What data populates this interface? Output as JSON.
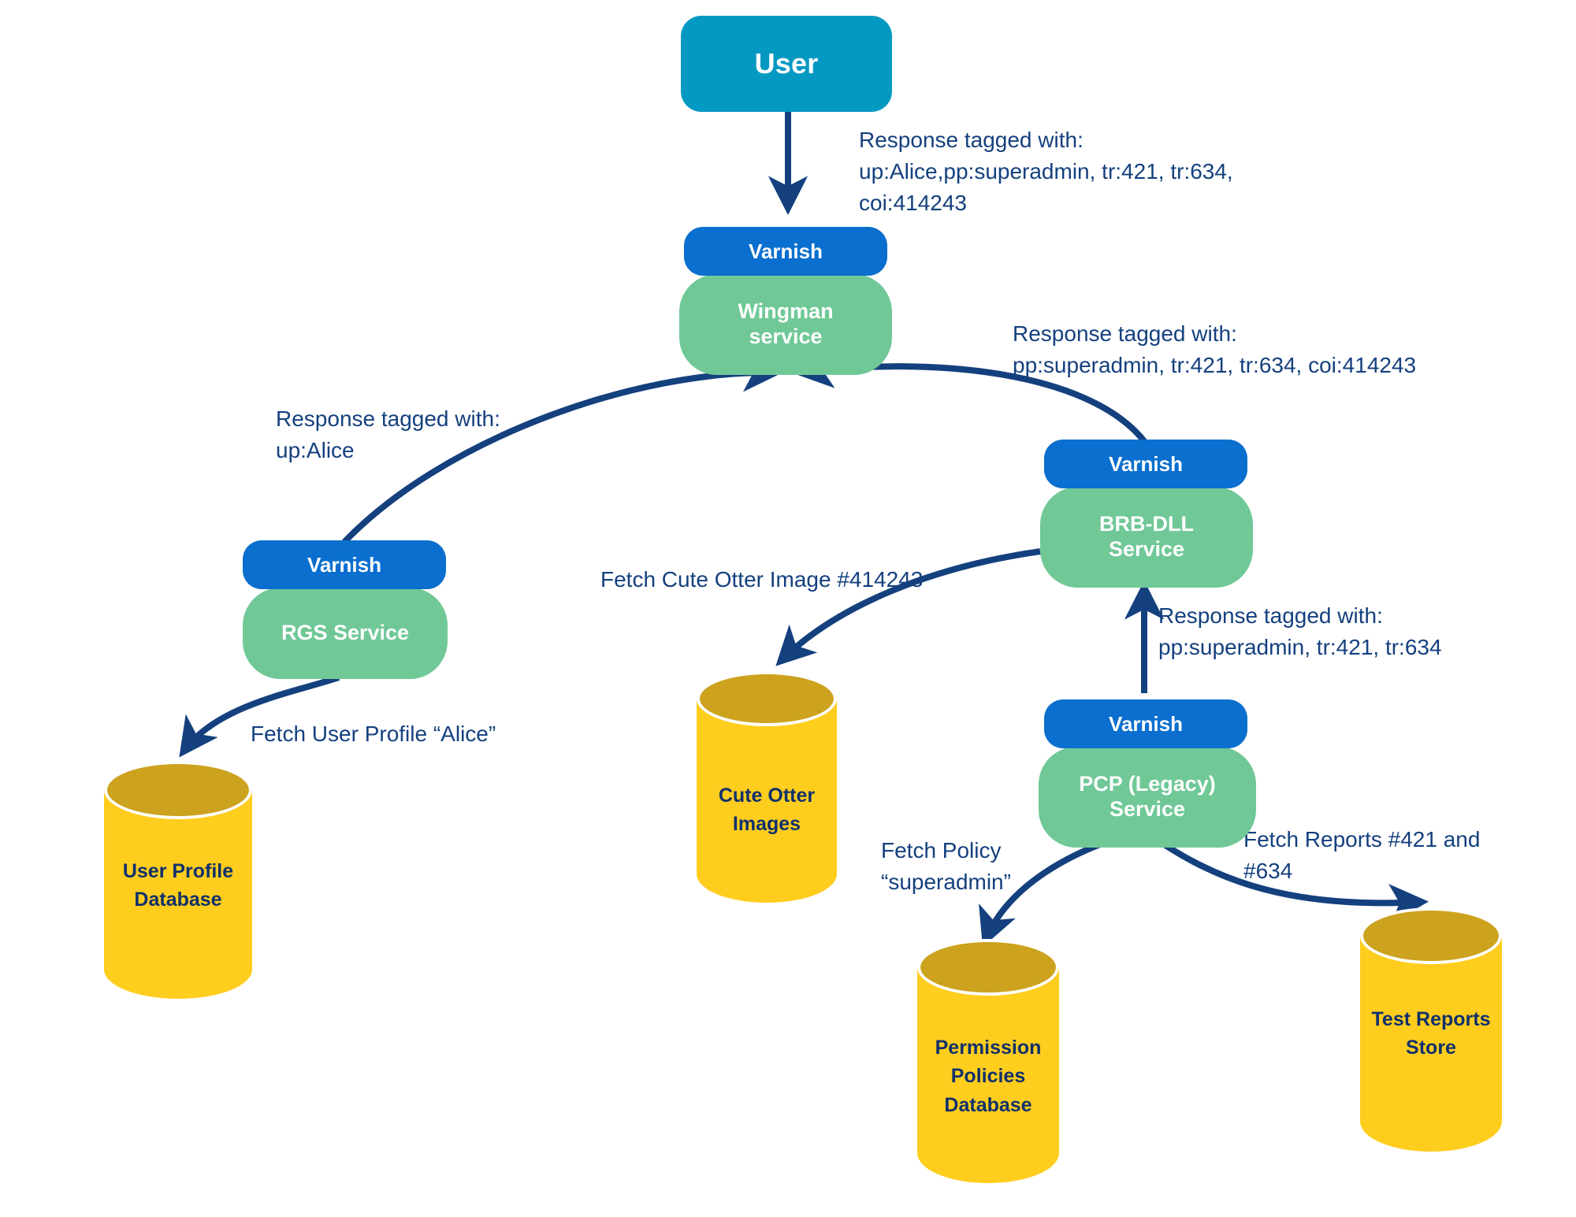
{
  "diagram": {
    "title": "Request tracing / cache tagging flow",
    "colors": {
      "actor": "#0499c2",
      "varnish": "#0a6fce",
      "service": "#70c897",
      "database_body": "#ffcd1e",
      "database_top": "#cca21e",
      "arrow": "#14407e",
      "label_text": "#14407e",
      "database_text": "#10306b",
      "background": "#ffffff"
    },
    "nodes": {
      "user": {
        "label": "User",
        "type": "actor"
      },
      "wingman": {
        "varnish_label": "Varnish",
        "service_label": "Wingman\nservice",
        "type": "service"
      },
      "rgs": {
        "varnish_label": "Varnish",
        "service_label": "RGS Service",
        "type": "service"
      },
      "brbdll": {
        "varnish_label": "Varnish",
        "service_label": "BRB-DLL\nService",
        "type": "service"
      },
      "pcp": {
        "varnish_label": "Varnish",
        "service_label": "PCP (Legacy)\nService",
        "type": "service"
      },
      "user_profile_db": {
        "label": "User\nProfile\nDatabase",
        "type": "database"
      },
      "otter_images_db": {
        "label": "Cute Otter\nImages",
        "type": "database"
      },
      "permission_policies_db": {
        "label": "Permission\nPolicies\nDatabase",
        "type": "database"
      },
      "test_reports_db": {
        "label": "Test\nReports\nStore",
        "type": "database"
      }
    },
    "edge_labels": {
      "user_to_wingman": "Response tagged with:\nup:Alice,pp:superadmin, tr:421, tr:634,\ncoi:414243",
      "brbdll_to_wingman": "Response tagged with:\npp:superadmin, tr:421, tr:634, coi:414243",
      "rgs_to_wingman": "Response tagged with:\nup:Alice",
      "rgs_to_user_profile_db": "Fetch User Profile “Alice”",
      "brbdll_to_otter_images": "Fetch Cute Otter Image #414243",
      "pcp_to_brbdll": "Response tagged with:\npp:superadmin, tr:421, tr:634",
      "pcp_to_permission_policies": "Fetch Policy\n“superadmin”",
      "pcp_to_test_reports": "Fetch Reports #421 and\n#634"
    }
  }
}
